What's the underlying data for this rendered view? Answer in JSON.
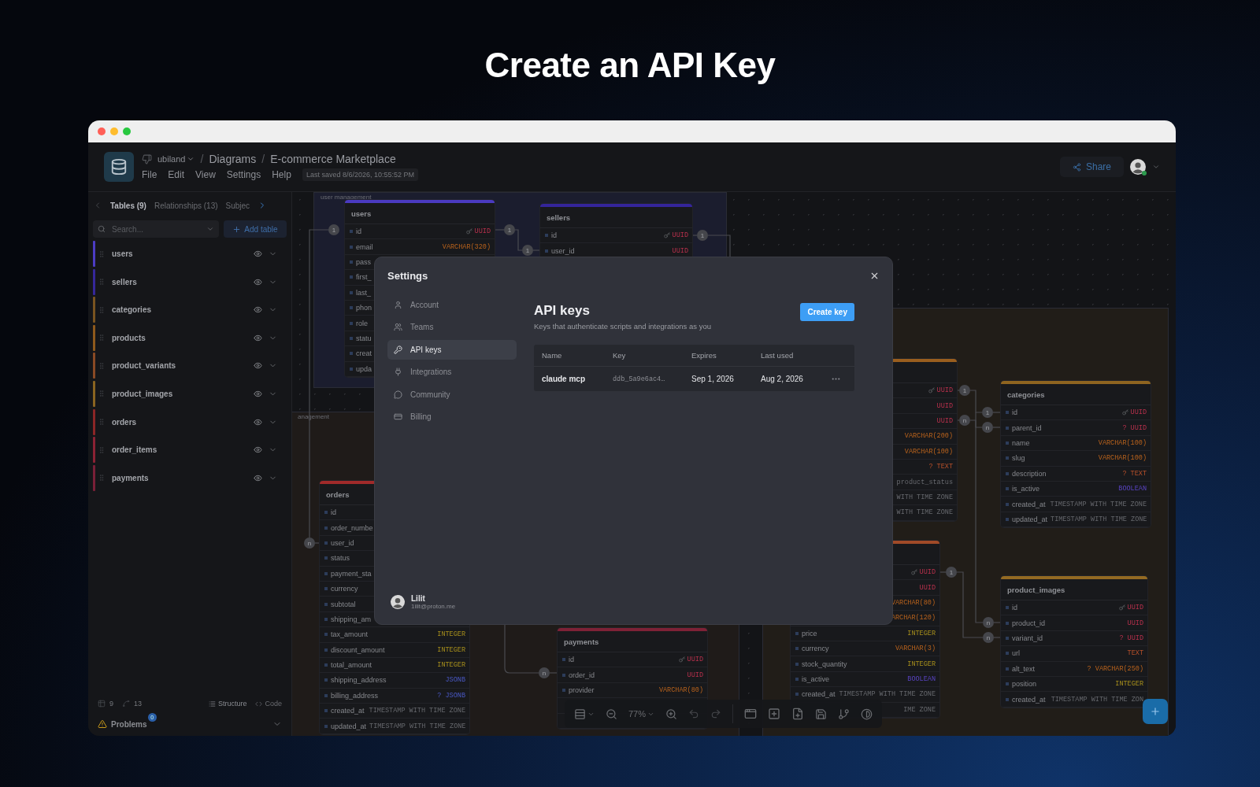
{
  "page_title": "Create an API Key",
  "header": {
    "workspace": "ubiland",
    "separator": "/",
    "breadcrumb": [
      "Diagrams",
      "E-commerce Marketplace"
    ],
    "menu": [
      "File",
      "Edit",
      "View",
      "Settings",
      "Help"
    ],
    "last_saved": "Last saved 8/6/2026, 10:55:52 PM",
    "share": "Share",
    "online": true
  },
  "sidebar": {
    "tabs": [
      {
        "label": "Tables (9)",
        "selected": true
      },
      {
        "label": "Relationships (13)",
        "selected": false
      },
      {
        "label": "Subjec",
        "selected": false
      }
    ],
    "search_placeholder": "Search...",
    "add_table": "Add table",
    "tables": [
      {
        "name": "users",
        "color": "#4c3cc4"
      },
      {
        "name": "sellers",
        "color": "#35279a"
      },
      {
        "name": "categories",
        "color": "#7a5420"
      },
      {
        "name": "products",
        "color": "#8f5a1c"
      },
      {
        "name": "product_variants",
        "color": "#8a4a24"
      },
      {
        "name": "product_images",
        "color": "#8a6420"
      },
      {
        "name": "orders",
        "color": "#8c2626"
      },
      {
        "name": "order_items",
        "color": "#8c2234"
      },
      {
        "name": "payments",
        "color": "#7a2038"
      }
    ],
    "table_count": "9",
    "relationship_count": "13",
    "view_modes": [
      {
        "label": "Structure",
        "selected": true
      },
      {
        "label": "Code",
        "selected": false
      }
    ],
    "problems": {
      "label": "Problems",
      "count": "0"
    }
  },
  "canvas": {
    "areas": [
      {
        "label": "user management",
        "color": "#1b1d2e"
      },
      {
        "label": "anagement",
        "color": "#1f1b19"
      },
      {
        "color": "#211d18"
      }
    ],
    "tables": [
      {
        "title": "users",
        "color": "#4a3ac0",
        "rows": [
          {
            "name": "id",
            "type": "UUID",
            "kind": "uuid",
            "pk": true
          },
          {
            "name": "email",
            "type": "VARCHAR(320)",
            "kind": "varchar"
          },
          {
            "name": "pass"
          },
          {
            "name": "first_"
          },
          {
            "name": "last_"
          },
          {
            "name": "phon"
          },
          {
            "name": "role"
          },
          {
            "name": "statu"
          },
          {
            "name": "creat"
          },
          {
            "name": "upda"
          }
        ]
      },
      {
        "title": "sellers",
        "color": "#34259a",
        "rows": [
          {
            "name": "id",
            "type": "UUID",
            "kind": "uuid",
            "pk": true
          },
          {
            "name": "user_id",
            "type": "UUID",
            "kind": "uuid"
          }
        ]
      },
      {
        "color": "#9a5e1e",
        "rows": [
          {
            "type": "UUID",
            "kind": "uuid",
            "pk": true
          },
          {
            "type": "UUID",
            "kind": "uuid"
          },
          {
            "type": "UUID",
            "kind": "uuid"
          },
          {
            "type": "VARCHAR(200)",
            "kind": "varchar"
          },
          {
            "type": "VARCHAR(100)",
            "kind": "varchar"
          },
          {
            "type": "? TEXT",
            "kind": "text"
          },
          {
            "type": "product_status",
            "kind": "enum"
          },
          {
            "type": "WITH TIME ZONE",
            "kind": "timestamp"
          },
          {
            "type": "WITH TIME ZONE",
            "kind": "timestamp"
          }
        ]
      },
      {
        "title": "categories",
        "color": "#8e6420",
        "rows": [
          {
            "name": "id",
            "type": "UUID",
            "kind": "uuid",
            "pk": true
          },
          {
            "name": "parent_id",
            "type": "? UUID",
            "kind": "uuid"
          },
          {
            "name": "name",
            "type": "VARCHAR(100)",
            "kind": "varchar"
          },
          {
            "name": "slug",
            "type": "VARCHAR(100)",
            "kind": "varchar"
          },
          {
            "name": "description",
            "type": "? TEXT",
            "kind": "text"
          },
          {
            "name": "is_active",
            "type": "BOOLEAN",
            "kind": "boolean"
          },
          {
            "name": "created_at",
            "type": "TIMESTAMP WITH TIME ZONE",
            "kind": "timestamp"
          },
          {
            "name": "updated_at",
            "type": "TIMESTAMP WITH TIME ZONE",
            "kind": "timestamp"
          }
        ]
      },
      {
        "color": "#a04a28",
        "rows": [
          {
            "type": "UUID",
            "kind": "uuid",
            "pk": true
          },
          {
            "type": "UUID",
            "kind": "uuid"
          },
          {
            "type": "VARCHAR(80)",
            "kind": "varchar"
          },
          {
            "type": "ARCHAR(120)",
            "kind": "varchar"
          },
          {
            "name": "price",
            "type": "INTEGER",
            "kind": "integer"
          },
          {
            "name": "currency",
            "type": "VARCHAR(3)",
            "kind": "varchar"
          },
          {
            "name": "stock_quantity",
            "type": "INTEGER",
            "kind": "integer"
          },
          {
            "name": "is_active",
            "type": "BOOLEAN",
            "kind": "boolean"
          },
          {
            "name": "created_at",
            "type": "TIMESTAMP WITH TIME ZONE",
            "kind": "timestamp"
          },
          {
            "type": "IME ZONE",
            "kind": "timestamp"
          }
        ]
      },
      {
        "title": "product_images",
        "color": "#946a22",
        "rows": [
          {
            "name": "id",
            "type": "UUID",
            "kind": "uuid",
            "pk": true
          },
          {
            "name": "product_id",
            "type": "UUID",
            "kind": "uuid"
          },
          {
            "name": "variant_id",
            "type": "? UUID",
            "kind": "uuid"
          },
          {
            "name": "url",
            "type": "TEXT",
            "kind": "text"
          },
          {
            "name": "alt_text",
            "type": "? VARCHAR(250)",
            "kind": "varchar"
          },
          {
            "name": "position",
            "type": "INTEGER",
            "kind": "integer"
          },
          {
            "name": "created_at",
            "type": "TIMESTAMP WITH TIME ZON",
            "kind": "timestamp"
          }
        ]
      },
      {
        "title": "orders",
        "color": "#a02a2a",
        "rows": [
          {
            "name": "id"
          },
          {
            "name": "order_numbe"
          },
          {
            "name": "user_id"
          },
          {
            "name": "status"
          },
          {
            "name": "payment_sta"
          },
          {
            "name": "currency"
          },
          {
            "name": "subtotal"
          },
          {
            "name": "shipping_am"
          },
          {
            "name": "tax_amount",
            "type": "INTEGER",
            "kind": "integer"
          },
          {
            "name": "discount_amount",
            "type": "INTEGER",
            "kind": "integer"
          },
          {
            "name": "total_amount",
            "type": "INTEGER",
            "kind": "integer"
          },
          {
            "name": "shipping_address",
            "type": "JSONB",
            "kind": "json"
          },
          {
            "name": "billing_address",
            "type": "? JSONB",
            "kind": "json"
          },
          {
            "name": "created_at",
            "type": "TIMESTAMP WITH TIME ZONE",
            "kind": "timestamp"
          },
          {
            "name": "updated_at",
            "type": "TIMESTAMP WITH TIME ZONE",
            "kind": "timestamp"
          }
        ]
      },
      {
        "title": "payments",
        "color": "#7e2236",
        "rows": [
          {
            "name": "id",
            "type": "UUID",
            "kind": "uuid",
            "pk": true
          },
          {
            "name": "order_id",
            "type": "UUID",
            "kind": "uuid"
          },
          {
            "name": "provider",
            "type": "VARCHAR(80)",
            "kind": "varchar"
          },
          {},
          {}
        ]
      }
    ],
    "cardinality": [
      "1",
      "1",
      "1",
      "1",
      "n",
      "n",
      "1",
      "n",
      "1",
      "n",
      "1",
      "n",
      "n"
    ]
  },
  "toolbar": {
    "zoom": "77%"
  },
  "settings": {
    "title": "Settings",
    "nav": [
      {
        "label": "Account",
        "selected": false
      },
      {
        "label": "Teams",
        "selected": false
      },
      {
        "label": "API keys",
        "selected": true
      },
      {
        "label": "Integrations",
        "selected": false
      },
      {
        "label": "Community",
        "selected": false
      },
      {
        "label": "Billing",
        "selected": false
      }
    ],
    "user": {
      "name": "Lilit",
      "email": "1ilit@proton.me"
    },
    "heading": "API keys",
    "description": "Keys that authenticate scripts and integrations as you",
    "create_button": "Create key",
    "columns": [
      "Name",
      "Key",
      "Expires",
      "Last used"
    ],
    "keys": [
      {
        "name": "claude mcp",
        "key": "ddb_5a9e6ac4…",
        "expires": "Sep 1, 2026",
        "last_used": "Aug 2, 2026"
      }
    ]
  }
}
